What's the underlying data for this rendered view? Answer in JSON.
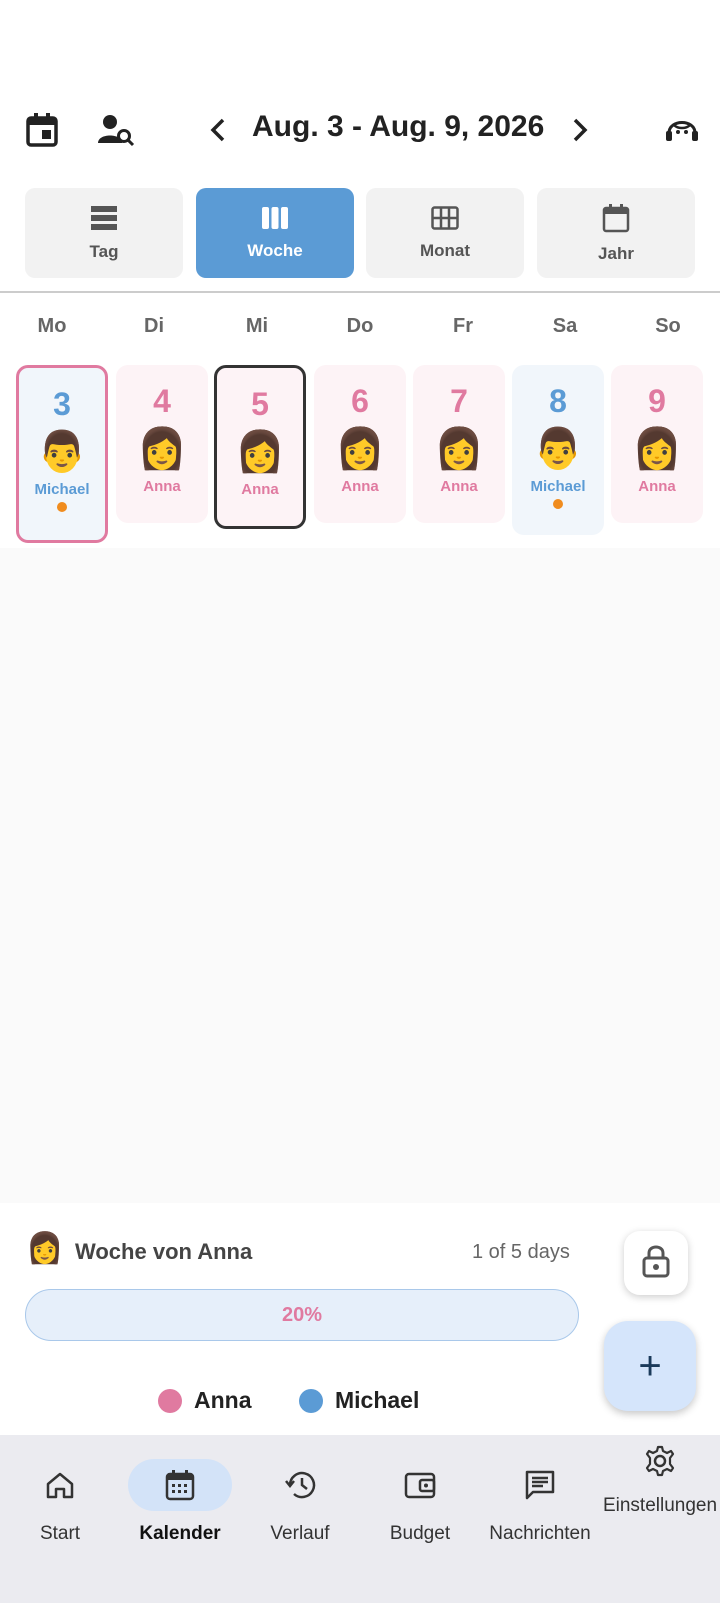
{
  "header": {
    "date_range": "Aug. 3 - Aug. 9, 2026"
  },
  "views": [
    {
      "label": "Tag"
    },
    {
      "label": "Woche"
    },
    {
      "label": "Monat"
    },
    {
      "label": "Jahr"
    }
  ],
  "day_names": [
    "Mo",
    "Di",
    "Mi",
    "Do",
    "Fr",
    "Sa",
    "So"
  ],
  "days": [
    {
      "num": "3",
      "emoji": "👨",
      "name": "Michael"
    },
    {
      "num": "4",
      "emoji": "👩",
      "name": "Anna"
    },
    {
      "num": "5",
      "emoji": "👩",
      "name": "Anna"
    },
    {
      "num": "6",
      "emoji": "👩",
      "name": "Anna"
    },
    {
      "num": "7",
      "emoji": "👩",
      "name": "Anna"
    },
    {
      "num": "8",
      "emoji": "👨",
      "name": "Michael"
    },
    {
      "num": "9",
      "emoji": "👩",
      "name": "Anna"
    }
  ],
  "summary": {
    "emoji": "👩",
    "title": "Woche von Anna",
    "count": "1 of 5 days",
    "progress_label": "20%",
    "progress_value": 0.2
  },
  "legend": [
    {
      "name": "Anna",
      "color": "#e07aa0"
    },
    {
      "name": "Michael",
      "color": "#5b9bd5"
    }
  ],
  "fab_label": "+",
  "nav": [
    {
      "label": "Start",
      "icon": "home-icon"
    },
    {
      "label": "Kalender",
      "icon": "calendar-icon"
    },
    {
      "label": "Verlauf",
      "icon": "history-icon"
    },
    {
      "label": "Budget",
      "icon": "wallet-icon"
    },
    {
      "label": "Nachrichten",
      "icon": "chat-icon"
    },
    {
      "label": "Einstellungen",
      "icon": "gear-icon"
    }
  ],
  "colors": {
    "accent": "#5b9bd5",
    "anna": "#e07aa0",
    "michael": "#5b9bd5",
    "marker": "#f08c1e"
  }
}
